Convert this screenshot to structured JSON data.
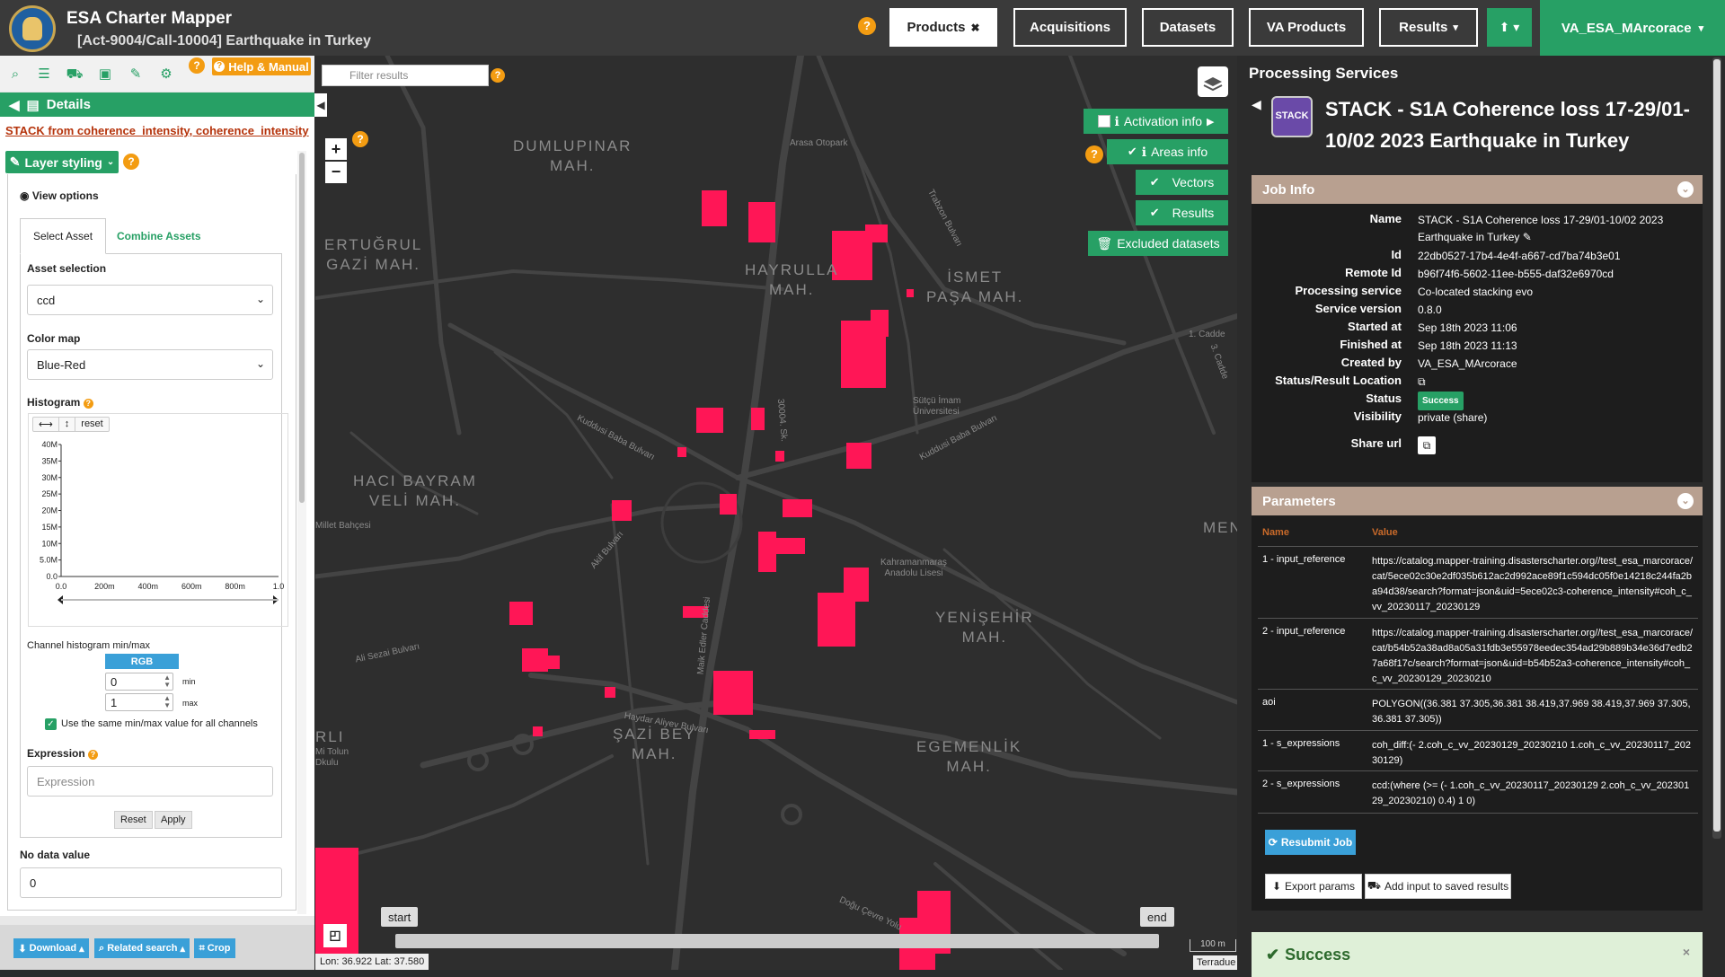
{
  "header": {
    "app_title": "ESA Charter Mapper",
    "subtitle": "[Act-9004/Call-10004] Earthquake in Turkey",
    "help": "?",
    "nav": [
      {
        "label": "Products",
        "icon": "✖"
      },
      {
        "label": "Acquisitions"
      },
      {
        "label": "Datasets"
      },
      {
        "label": "VA Products"
      },
      {
        "label": "Results",
        "icon": "▾"
      }
    ],
    "user": "VA_ESA_MArcorace",
    "user_caret": "▾",
    "upload_icon": "⬆ ▾",
    "accent": "#27a065"
  },
  "left": {
    "help_manual": "Help & Manual",
    "details": "Details",
    "stack_label": "STACK from coherence_intensity, coherence_intensity",
    "layer_styling": "Layer styling",
    "view_options": "View options",
    "tabs": [
      "Select Asset",
      "Combine Assets"
    ],
    "asset_selection_label": "Asset selection",
    "asset_selection_value": "ccd",
    "color_map_label": "Color map",
    "color_map_value": "Blue-Red",
    "histogram_label": "Histogram",
    "hist_tools": [
      "⟷",
      "↕",
      "reset"
    ],
    "hist_y_ticks": [
      "40M",
      "35M",
      "30M",
      "25M",
      "20M",
      "15M",
      "10M",
      "5.0M",
      "0.0"
    ],
    "hist_x_ticks": [
      "0.0",
      "200m",
      "400m",
      "600m",
      "800m",
      "1.0"
    ],
    "channel_hist_label": "Channel histogram min/max",
    "rgb": "RGB",
    "min_value": "0",
    "min_label": "min",
    "max_value": "1",
    "max_label": "max",
    "same_minmax": "Use the same min/max value for all channels",
    "expression_label": "Expression",
    "expression_placeholder": "Expression",
    "reset": "Reset",
    "apply": "Apply",
    "nodata_label": "No data value",
    "nodata_value": "0",
    "bottom": [
      "Download",
      "Related search",
      "Crop"
    ]
  },
  "map": {
    "filter_placeholder": "Filter results",
    "zoom_in": "+",
    "zoom_out": "−",
    "buttons": [
      "Activation info",
      "Areas info",
      "Vectors",
      "Results",
      "Excluded datasets"
    ],
    "districts": [
      "DUMLUPINAR\nMAH.",
      "ERTUĞRUL\nGAZİ MAH.",
      "HAYRULLA\nMAH.",
      "İSMET\nPAŞA MAH.",
      "HACI BAYRAM\nVELİ MAH.",
      "YENİŞEHİR\nMAH.",
      "ŞAZİ BEY\nMAH.",
      "EGEMENLİK\nMAH.",
      "MEN",
      "RLI"
    ],
    "streets": [
      "Arasa Otopark",
      "Trabzon Bulvarı",
      "Kuddusi Baba Bulvarı",
      "Kuddusi Baba Bulvarı",
      "Sütçü İmam\nÜniversitesi",
      "Ali Sezai Bulvarı",
      "Haydar Aliyev Bulvarı",
      "Kahramanmaraş\nAnadolu Lisesi",
      "Doğu Çevre Yolu",
      "Millet Bahçesi",
      "Mi Tolun\nDkulu",
      "1. Cadde",
      "3. Cadde",
      "Akif Bulvarı",
      "Maik Edler Caddesi",
      "30004. Sk."
    ],
    "time_start": "start",
    "time_end": "end",
    "scale": "100 m",
    "coords": "Lon: 36.922 Lat: 37.580",
    "attribution": "Terradue",
    "damage_color": "#ff1656"
  },
  "right": {
    "title": "Processing Services",
    "badge": "STACK",
    "job_title": "STACK - S1A Coherence loss 17-29/01-10/02 2023 Earthquake in Turkey",
    "job_info_head": "Job Info",
    "job_info": [
      {
        "k": "Name",
        "v": "STACK - S1A Coherence loss 17-29/01-10/02 2023 Earthquake in Turkey ✎"
      },
      {
        "k": "Id",
        "v": "22db0527-17b4-4e4f-a667-cd7ba74b3e01"
      },
      {
        "k": "Remote Id",
        "v": "b96f74f6-5602-11ee-b555-daf32e6970cd"
      },
      {
        "k": "Processing service",
        "v": "Co-located stacking evo"
      },
      {
        "k": "Service version",
        "v": "0.8.0"
      },
      {
        "k": "Started at",
        "v": "Sep 18th 2023 11:06"
      },
      {
        "k": "Finished at",
        "v": "Sep 18th 2023 11:13"
      },
      {
        "k": "Created by",
        "v": "VA_ESA_MArcorace"
      },
      {
        "k": "Status/Result Location",
        "v": "⧉"
      },
      {
        "k": "Status",
        "v": "Success"
      },
      {
        "k": "Visibility",
        "v": "private (share)"
      },
      {
        "k": "Share url",
        "v": "⧉"
      }
    ],
    "params_head": "Parameters",
    "param_cols": [
      "Name",
      "Value"
    ],
    "params": [
      {
        "n": "1 - input_reference",
        "v": "https://catalog.mapper-training.disasterscharter.org//test_esa_marcorace/cat/5ece02c30e2df035b612ac2d992ace89f1c594dc05f0e14218c244fa2ba94d38/search?format=json&uid=5ece02c3-coherence_intensity#coh_c_vv_20230117_20230129"
      },
      {
        "n": "2 - input_reference",
        "v": "https://catalog.mapper-training.disasterscharter.org//test_esa_marcorace/cat/b54b52a38ad8a05a31fdb3e55978eedec354ad29b889b34e36d7edb27a68f17c/search?format=json&uid=b54b52a3-coherence_intensity#coh_c_vv_20230129_20230210"
      },
      {
        "n": "aoi",
        "v": "POLYGON((36.381 37.305,36.381 38.419,37.969 38.419,37.969 37.305,36.381 37.305))"
      },
      {
        "n": "1 - s_expressions",
        "v": "coh_diff:(- 2.coh_c_vv_20230129_20230210 1.coh_c_vv_20230117_20230129)"
      },
      {
        "n": "2 - s_expressions",
        "v": "ccd:(where (>= (- 1.coh_c_vv_20230117_20230129 2.coh_c_vv_20230129_20230210) 0.4) 1 0)"
      }
    ],
    "resubmit": "Resubmit Job",
    "export_params": "Export params",
    "add_input": "Add input to saved results",
    "success": "Success",
    "close": "×"
  }
}
